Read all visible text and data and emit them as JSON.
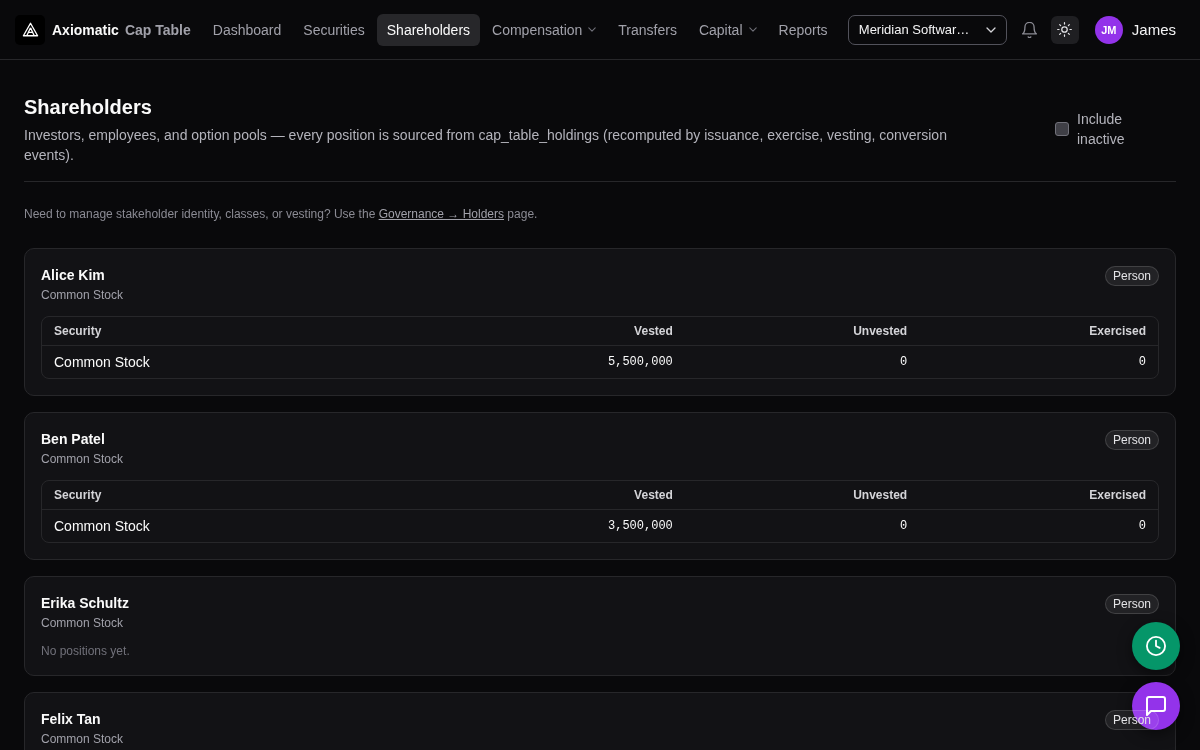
{
  "app": {
    "brand": "Axiomatic",
    "product": "Cap Table"
  },
  "nav": [
    {
      "label": "Dashboard",
      "selected": false,
      "dropdown": false
    },
    {
      "label": "Securities",
      "selected": false,
      "dropdown": false
    },
    {
      "label": "Shareholders",
      "selected": true,
      "dropdown": false
    },
    {
      "label": "Compensation",
      "selected": false,
      "dropdown": true
    },
    {
      "label": "Transfers",
      "selected": false,
      "dropdown": false
    },
    {
      "label": "Capital",
      "selected": false,
      "dropdown": true
    },
    {
      "label": "Reports",
      "selected": false,
      "dropdown": false
    }
  ],
  "company_select": {
    "value": "Meridian Softwar…"
  },
  "user": {
    "initials": "JM",
    "name": "James"
  },
  "page": {
    "title": "Shareholders",
    "subtitle": "Investors, employees, and option pools — every position is sourced from cap_table_holdings (recomputed by issuance, exercise, vesting, conversion events).",
    "include_inactive": {
      "label": "Include inactive",
      "checked": false
    },
    "note": {
      "before": "Need to manage stakeholder identity, classes, or vesting? Use the ",
      "link": "Governance → Holders",
      "after": " page."
    }
  },
  "shareholders": [
    {
      "name": "Alice Kim",
      "class": "Common Stock",
      "badge": "Person",
      "table": {
        "columns": [
          "Security",
          "Vested",
          "Unvested",
          "Exercised"
        ],
        "rows": [
          [
            "Common Stock",
            "5,500,000",
            "0",
            "0"
          ]
        ]
      }
    },
    {
      "name": "Ben Patel",
      "class": "Common Stock",
      "badge": "Person",
      "table": {
        "columns": [
          "Security",
          "Vested",
          "Unvested",
          "Exercised"
        ],
        "rows": [
          [
            "Common Stock",
            "3,500,000",
            "0",
            "0"
          ]
        ]
      }
    },
    {
      "name": "Erika Schultz",
      "class": "Common Stock",
      "badge": "Person",
      "empty_message": "No positions yet."
    },
    {
      "name": "Felix Tan",
      "class": "Common Stock",
      "badge": "Person"
    }
  ],
  "floating_buttons": [
    {
      "kind": "history"
    },
    {
      "kind": "chat"
    }
  ]
}
